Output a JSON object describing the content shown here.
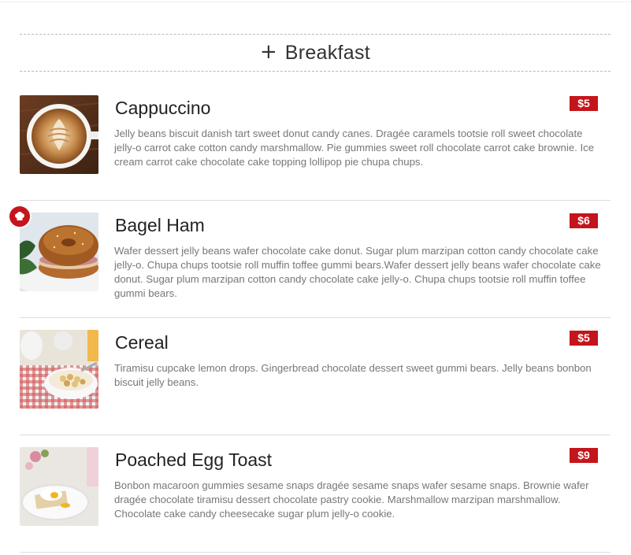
{
  "section": {
    "icon": "plus-icon",
    "plus": "+",
    "title": "Breakfast"
  },
  "items": [
    {
      "name": "Cappuccino",
      "price": "$5",
      "description": "Jelly beans biscuit danish tart sweet donut candy canes. Dragée caramels tootsie roll sweet chocolate jelly-o carrot cake cotton candy marshmallow. Pie gummies sweet roll chocolate carrot cake brownie. Ice cream carrot cake chocolate cake topping lollipop pie chupa chups.",
      "image": "cappuccino-photo",
      "chef_special": false
    },
    {
      "name": "Bagel Ham",
      "price": "$6",
      "description": "Wafer dessert jelly beans wafer chocolate cake donut. Sugar plum marzipan cotton candy chocolate cake jelly-o. Chupa chups tootsie roll muffin toffee gummi bears.Wafer dessert jelly beans wafer chocolate cake donut. Sugar plum marzipan cotton candy chocolate cake jelly-o. Chupa chups tootsie roll muffin toffee gummi bears.",
      "image": "bagel-ham-photo",
      "chef_special": true,
      "badge_icon": "chef-hat-icon"
    },
    {
      "name": "Cereal",
      "price": "$5",
      "description": "Tiramisu cupcake lemon drops. Gingerbread chocolate dessert sweet gummi bears. Jelly beans bonbon biscuit jelly beans.",
      "image": "cereal-photo",
      "chef_special": false
    },
    {
      "name": "Poached Egg Toast",
      "price": "$9",
      "description": "Bonbon macaroon gummies sesame snaps dragée sesame snaps wafer sesame snaps. Brownie wafer dragée chocolate tiramisu dessert chocolate pastry cookie. Marshmallow marzipan marshmallow. Chocolate cake candy cheesecake sugar plum jelly-o cookie.",
      "image": "poached-egg-toast-photo",
      "chef_special": false
    }
  ],
  "colors": {
    "price_badge": "#c4151c",
    "text": "#222222",
    "description": "#777777",
    "divider": "#dddddd"
  }
}
